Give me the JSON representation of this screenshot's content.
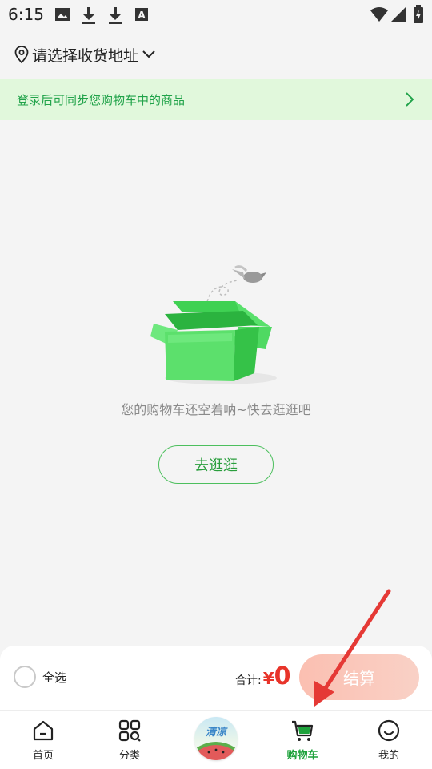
{
  "status_bar": {
    "time": "6:15"
  },
  "address": {
    "text": "请选择收货地址"
  },
  "login_banner": {
    "text": "登录后可同步您购物车中的商品"
  },
  "empty_state": {
    "message": "您的购物车还空着呐~快去逛逛吧",
    "button_label": "去逛逛"
  },
  "checkout": {
    "select_all_label": "全选",
    "total_label": "合计:",
    "currency": "¥",
    "total_amount": "0",
    "checkout_label": "结算"
  },
  "tabs": [
    {
      "label": "首页",
      "icon": "home-icon"
    },
    {
      "label": "分类",
      "icon": "category-icon"
    },
    {
      "label": "",
      "icon": "promo-badge-icon",
      "badge_text": "清凉"
    },
    {
      "label": "购物车",
      "icon": "cart-icon",
      "active": true
    },
    {
      "label": "我的",
      "icon": "profile-icon"
    }
  ],
  "colors": {
    "accent_green": "#1ea23c",
    "banner_bg": "#e1f8dc",
    "price_red": "#e8342a",
    "checkout_button": "#fbbfb1",
    "annotation_arrow": "#e53935"
  }
}
